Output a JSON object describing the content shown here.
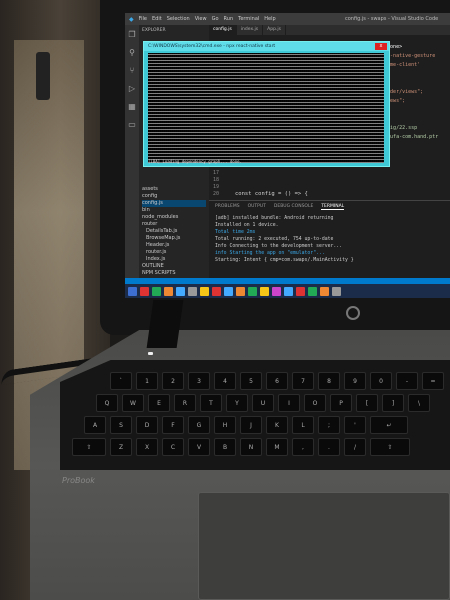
{
  "window": {
    "title": "config.js - swaps - Visual Studio Code",
    "menu": [
      "File",
      "Edit",
      "Selection",
      "View",
      "Go",
      "Run",
      "Terminal",
      "Help"
    ]
  },
  "explorer": {
    "header": "EXPLORER",
    "items": [
      "assets",
      "config",
      "config.js",
      "bin",
      "node_modules",
      "router",
      "DetailsTab.js",
      "BrowseMap.js",
      "Header.js",
      "router.js",
      "Index.js"
    ],
    "footer": [
      "OUTLINE",
      "NPM SCRIPTS"
    ]
  },
  "editor": {
    "tabs": [
      "config.js",
      "index.js",
      "App.js"
    ],
    "line_numbers": [
      "17",
      "18",
      "19",
      "20"
    ],
    "main_line": "const config = () => {",
    "right_code": [
      "<appDone>",
      "react-native-gesture",
      "s-frame-client'",
      "\"/Header/views\";",
      "ng/views\";",
      "/config/22.ssp",
      "d/12/ufa-com.hand.ptr"
    ]
  },
  "panel": {
    "tabs": [
      "PROBLEMS",
      "OUTPUT",
      "DEBUG CONSOLE",
      "TERMINAL"
    ],
    "lines": [
      "[adb] installed bundle: Android returning",
      "Installed on 1 device.",
      "",
      "Total time 2ms",
      "Total running: 2 executed, 754 up-to-date",
      "Info Connecting to the development server...",
      "",
      "info Starting the app on \"emulator\"...",
      "Starting: Intent { cmp=com.swaps/.MainActivity }"
    ]
  },
  "overlay": {
    "title": "C:\\WINDOWS\\system32\\cmd.exe - npx react-native start",
    "close": "x",
    "footer": "[iBA]  Loading dependency graph... done."
  },
  "laptop": {
    "model": "ProBook"
  },
  "colors": {
    "overlay": "#3fc9d6",
    "vscode_bg": "#1e1e1e",
    "statusbar": "#007acc",
    "taskbar": "#1b2b4a"
  }
}
